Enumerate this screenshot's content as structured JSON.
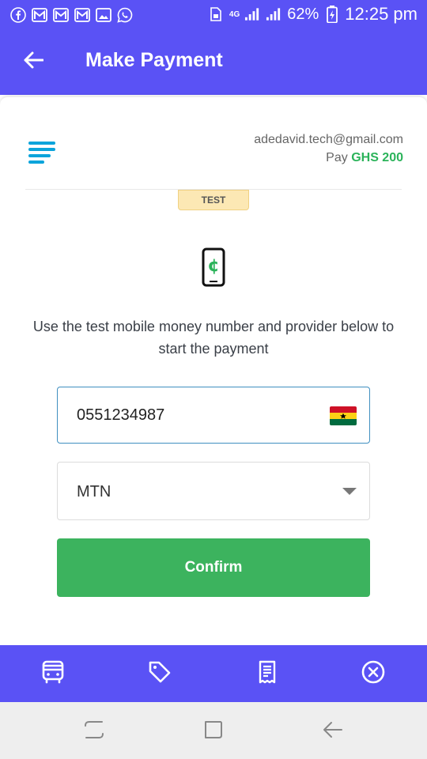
{
  "status_bar": {
    "network": "4G",
    "battery_percent": "62%",
    "time": "12:25 pm",
    "notification_icons": [
      "facebook-icon",
      "gmail-icon",
      "gmail-icon",
      "gmail-icon",
      "gallery-icon",
      "whatsapp-icon"
    ]
  },
  "app_bar": {
    "title": "Make Payment",
    "back_icon": "arrow-left-icon"
  },
  "payment": {
    "email": "adedavid.tech@gmail.com",
    "pay_label": "Pay",
    "amount": "GHS 200",
    "mode_badge": "TEST",
    "instruction": "Use the test mobile money number and provider below to start the payment",
    "phone_number": "0551234987",
    "provider": "MTN",
    "confirm_label": "Confirm"
  },
  "bottom_toolbar": {
    "icons": [
      "bus-icon",
      "tag-icon",
      "receipt-icon",
      "close-circle-icon"
    ]
  },
  "nav_bar": {
    "icons": [
      "recents-icon",
      "home-icon",
      "back-icon"
    ]
  },
  "colors": {
    "primary": "#5a52f5",
    "success": "#3cb35e",
    "amount": "#2bb35a",
    "badge_bg": "#fce8b4",
    "field_border_focus": "#3f8fc0"
  }
}
